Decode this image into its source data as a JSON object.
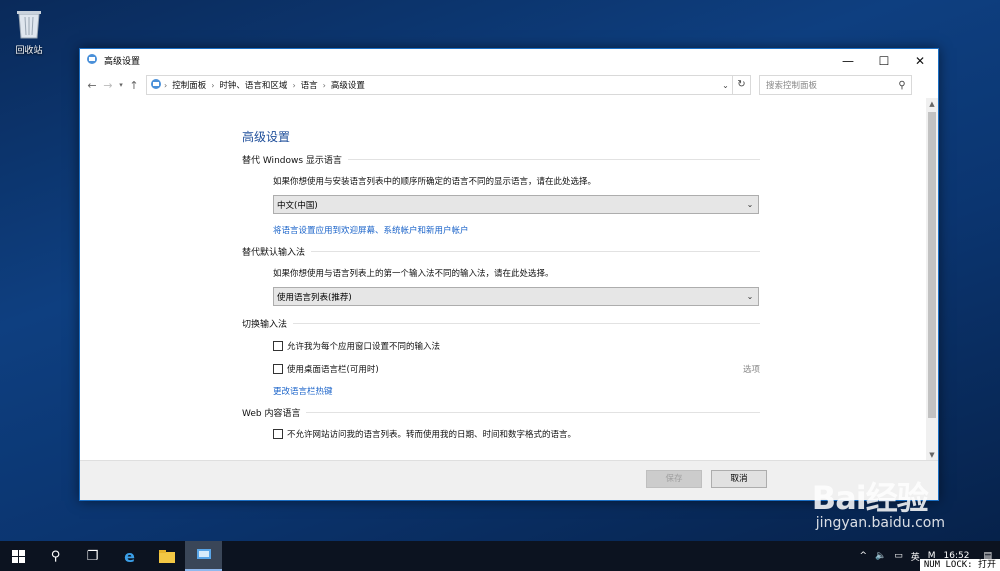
{
  "desktop": {
    "recycle_bin_label": "回收站"
  },
  "window": {
    "title": "高级设置",
    "controls": {
      "minimize": "—",
      "maximize": "☐",
      "close": "✕"
    }
  },
  "address": {
    "breadcrumbs": [
      "控制面板",
      "时钟、语言和区域",
      "语言",
      "高级设置"
    ],
    "search_placeholder": "搜索控制面板"
  },
  "page": {
    "title": "高级设置",
    "display_language": {
      "heading": "替代 Windows 显示语言",
      "description": "如果你想使用与安装语言列表中的顺序所确定的语言不同的显示语言，请在此处选择。",
      "selected": "中文(中国)",
      "link": "将语言设置应用到欢迎屏幕、系统帐户和新用户帐户"
    },
    "default_input": {
      "heading": "替代默认输入法",
      "description": "如果你想使用与语言列表上的第一个输入法不同的输入法，请在此处选择。",
      "selected": "使用语言列表(推荐)"
    },
    "switch_input": {
      "heading": "切换输入法",
      "option1": "允许我为每个应用窗口设置不同的输入法",
      "option2": "使用桌面语言栏(可用时)",
      "option2_link": "选项",
      "hotkey_link": "更改语言栏热键"
    },
    "web_language": {
      "heading": "Web 内容语言",
      "option": "不允许网站访问我的语言列表。转而使用我的日期、时间和数字格式的语言。"
    }
  },
  "footer": {
    "save": "保存",
    "cancel": "取消"
  },
  "taskbar": {
    "ime": "英",
    "ime_mode": "M",
    "time": "16:52"
  },
  "watermark": {
    "brand": "Bai经验",
    "url": "jingyan.baidu.com"
  },
  "status": {
    "numlock": "NUM LOCK: 打开"
  }
}
